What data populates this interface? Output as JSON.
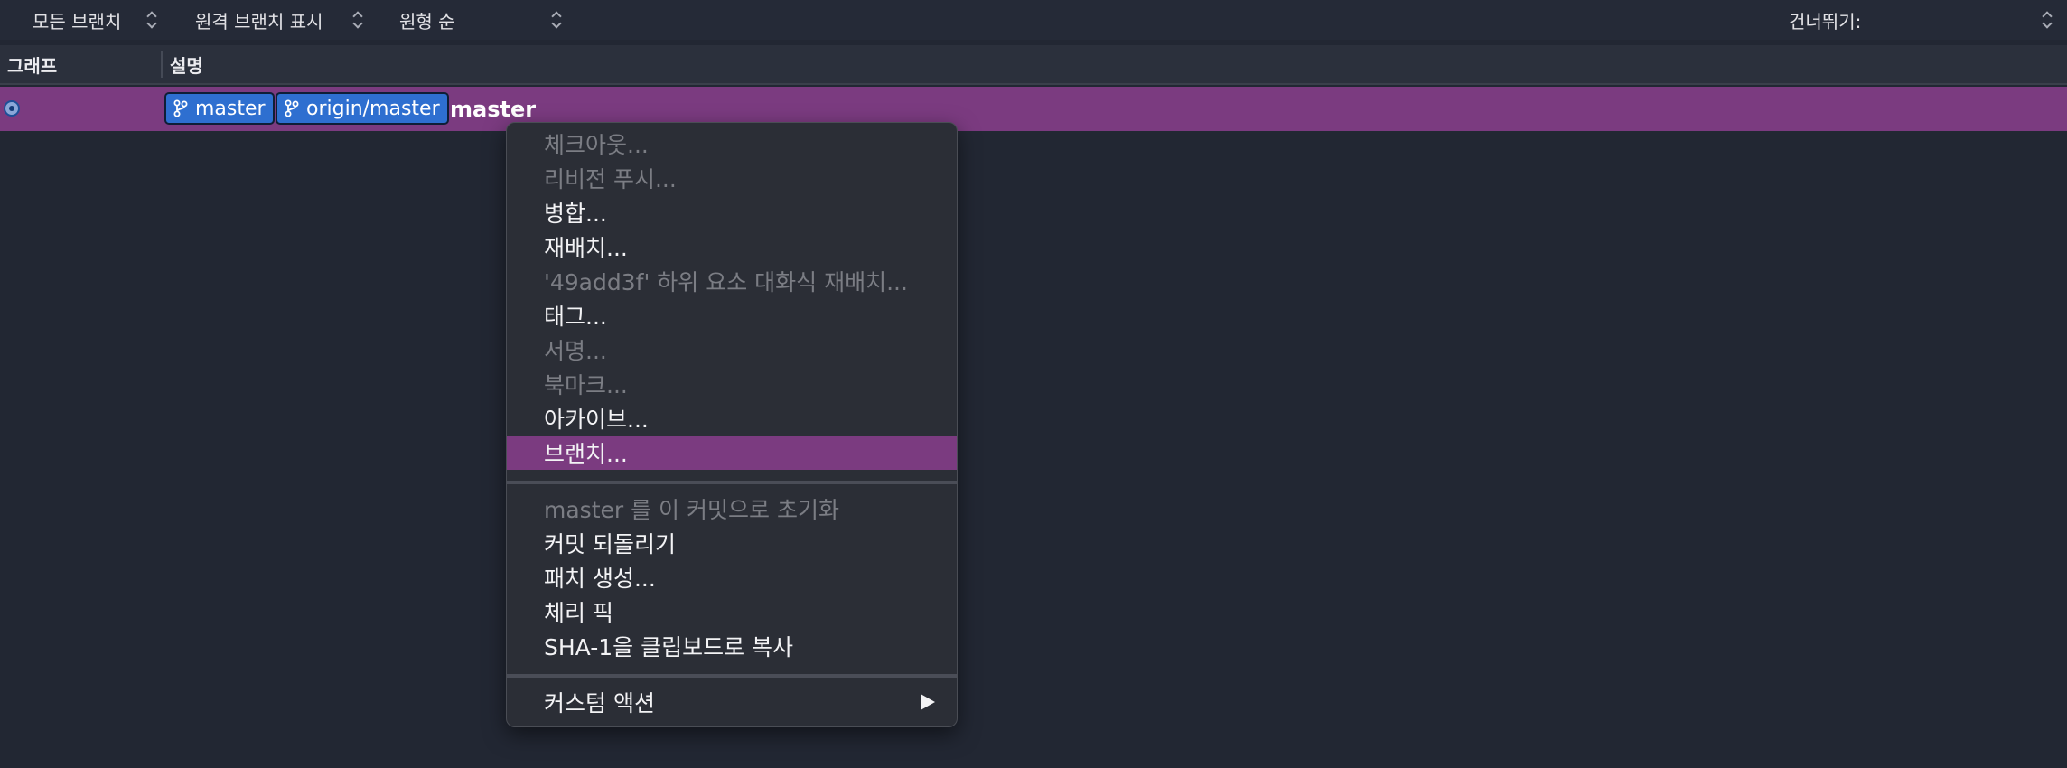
{
  "toolbar": {
    "branches_filter": "모든 브랜치",
    "remote_filter": "원격 브랜치 표시",
    "order": "원형 순",
    "jump_label": "건너뛰기:"
  },
  "columns": {
    "graph": "그래프",
    "description": "설명"
  },
  "commit_row": {
    "badges": [
      "master",
      "origin/master"
    ],
    "message": "master"
  },
  "context_menu": {
    "items": [
      {
        "label": "체크아웃...",
        "enabled": false
      },
      {
        "label": "리비전 푸시...",
        "enabled": false
      },
      {
        "label": "병합...",
        "enabled": true
      },
      {
        "label": "재배치...",
        "enabled": true
      },
      {
        "label": "'49add3f' 하위 요소 대화식 재배치...",
        "enabled": false
      },
      {
        "label": "태그...",
        "enabled": true
      },
      {
        "label": "서명...",
        "enabled": false
      },
      {
        "label": "북마크...",
        "enabled": false
      },
      {
        "label": "아카이브...",
        "enabled": true
      },
      {
        "label": "브랜치...",
        "enabled": true,
        "highlighted": true
      },
      {
        "label": "master 를 이 커밋으로 초기화",
        "enabled": false
      },
      {
        "label": "커밋 되돌리기",
        "enabled": true
      },
      {
        "label": "패치 생성...",
        "enabled": true
      },
      {
        "label": "체리 픽",
        "enabled": true
      },
      {
        "label": "SHA-1을 클립보드로 복사",
        "enabled": true
      },
      {
        "label": "커스텀 액션",
        "enabled": true,
        "submenu": true
      }
    ]
  },
  "colors": {
    "selection": "#7b3b80",
    "branch_badge": "#2e6fd0",
    "background": "#222733"
  }
}
